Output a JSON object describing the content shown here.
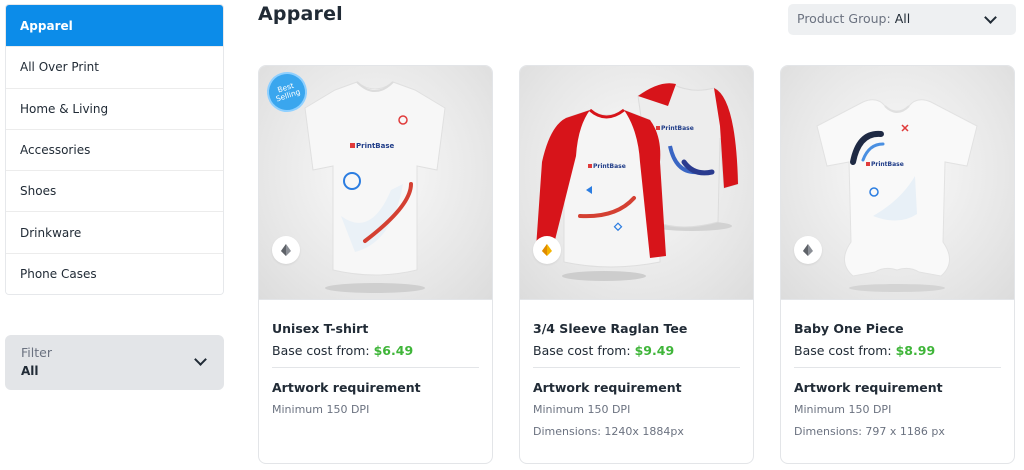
{
  "sidebar": {
    "items": [
      {
        "label": "Apparel",
        "active": true
      },
      {
        "label": "All Over Print"
      },
      {
        "label": "Home & Living"
      },
      {
        "label": "Accessories"
      },
      {
        "label": "Shoes"
      },
      {
        "label": "Drinkware"
      },
      {
        "label": "Phone Cases"
      }
    ],
    "filter": {
      "label": "Filter",
      "value": "All"
    }
  },
  "header": {
    "title": "Apparel",
    "product_group": {
      "label": "Product Group:",
      "value": "All"
    }
  },
  "products": [
    {
      "title": "Unisex T-shirt",
      "base_cost_label": "Base cost from:",
      "price": "$6.49",
      "badge": "Best Selling",
      "brand_mark": "PrintBase",
      "artwork_title": "Artwork requirement",
      "specs": [
        "Minimum 150 DPI"
      ]
    },
    {
      "title": "3/4 Sleeve Raglan Tee",
      "base_cost_label": "Base cost from:",
      "price": "$9.49",
      "brand_mark": "PrintBase",
      "artwork_title": "Artwork requirement",
      "specs": [
        "Minimum 150 DPI",
        "Dimensions: 1240x 1884px"
      ]
    },
    {
      "title": "Baby One Piece",
      "base_cost_label": "Base cost from:",
      "price": "$8.99",
      "brand_mark": "PrintBase",
      "artwork_title": "Artwork requirement",
      "specs": [
        "Minimum 150 DPI",
        "Dimensions: 797 x 1186 px"
      ]
    }
  ],
  "colors": {
    "accent": "#0c8ce9",
    "price_green": "#3fb539",
    "raglan_red": "#d7141a",
    "badge_blue": "#3aa6ee"
  }
}
